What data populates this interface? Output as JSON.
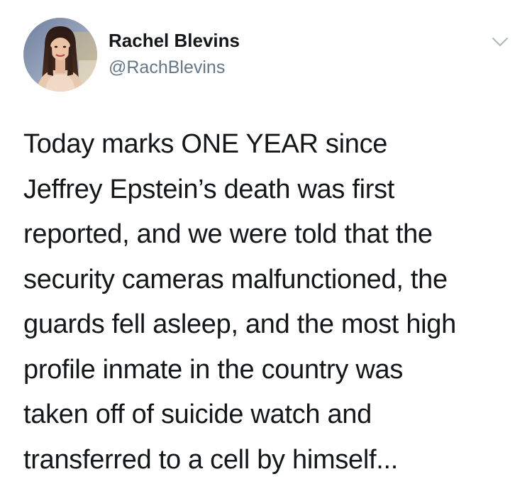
{
  "author": {
    "display_name": "Rachel Blevins",
    "handle": "@RachBlevins",
    "avatar_icon": "profile-photo"
  },
  "header": {
    "menu_icon": "chevron-down-icon"
  },
  "tweet": {
    "text": "Today marks ONE YEAR since\nJeffrey Epstein’s death was first\nreported, and we were told that the\nsecurity cameras malfunctioned, the\nguards fell asleep, and the most high\nprofile inmate in the country was\ntaken off of suicide watch and\ntransferred to a cell by himself..."
  },
  "colors": {
    "text_primary": "#14171a",
    "text_secondary": "#657786",
    "caret": "#aab8c2",
    "background": "#ffffff"
  }
}
